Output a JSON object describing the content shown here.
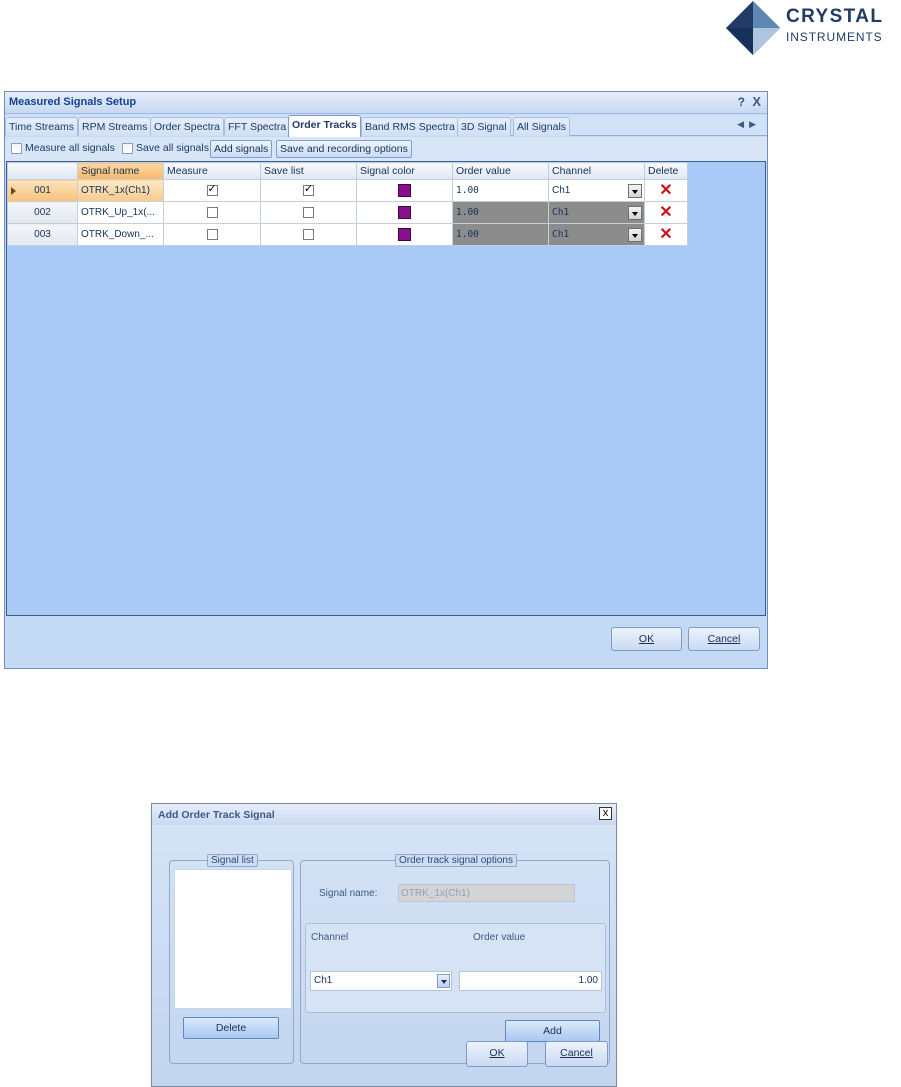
{
  "logo": {
    "line1": "CRYSTAL",
    "line2": "INSTRUMENTS"
  },
  "main_dialog": {
    "title": "Measured Signals Setup",
    "help_label": "?",
    "close_label": "X",
    "tabs": [
      "Time Streams",
      "RPM Streams",
      "Order Spectra",
      "FFT Spectra",
      "Order Tracks",
      "Band RMS Spectra",
      "3D Signal",
      "All Signals"
    ],
    "active_tab": "Order Tracks",
    "toolbar": {
      "measure_all": "Measure all signals",
      "save_all": "Save all signals",
      "add_signals": "Add signals",
      "save_recording": "Save and recording options"
    },
    "columns": [
      "Signal name",
      "Measure",
      "Save list",
      "Signal color",
      "Order value",
      "Channel",
      "Delete"
    ],
    "rows": [
      {
        "id": "001",
        "name": "OTRK_1x(Ch1)",
        "measure": true,
        "save": true,
        "order": "1.00",
        "channel": "Ch1"
      },
      {
        "id": "002",
        "name": "OTRK_Up_1x(...",
        "measure": false,
        "save": false,
        "order": "1.00",
        "channel": "Ch1"
      },
      {
        "id": "003",
        "name": "OTRK_Down_...",
        "measure": false,
        "save": false,
        "order": "1.00",
        "channel": "Ch1"
      }
    ],
    "signal_color": "#8a0f8f",
    "ok_label": "OK",
    "cancel_label": "Cancel"
  },
  "add_dialog": {
    "title": "Add Order Track Signal",
    "close_label": "x",
    "signal_list_label": "Signal list",
    "delete_label": "Delete",
    "options_label": "Order track signal options",
    "signal_name_label": "Signal name:",
    "signal_name_value": "OTRK_1x(Ch1)",
    "channel_label": "Channel",
    "order_value_label": "Order value",
    "channel_value": "Ch1",
    "order_value": "1.00",
    "add_label": "Add",
    "ok_label": "OK",
    "cancel_label": "Cancel"
  }
}
